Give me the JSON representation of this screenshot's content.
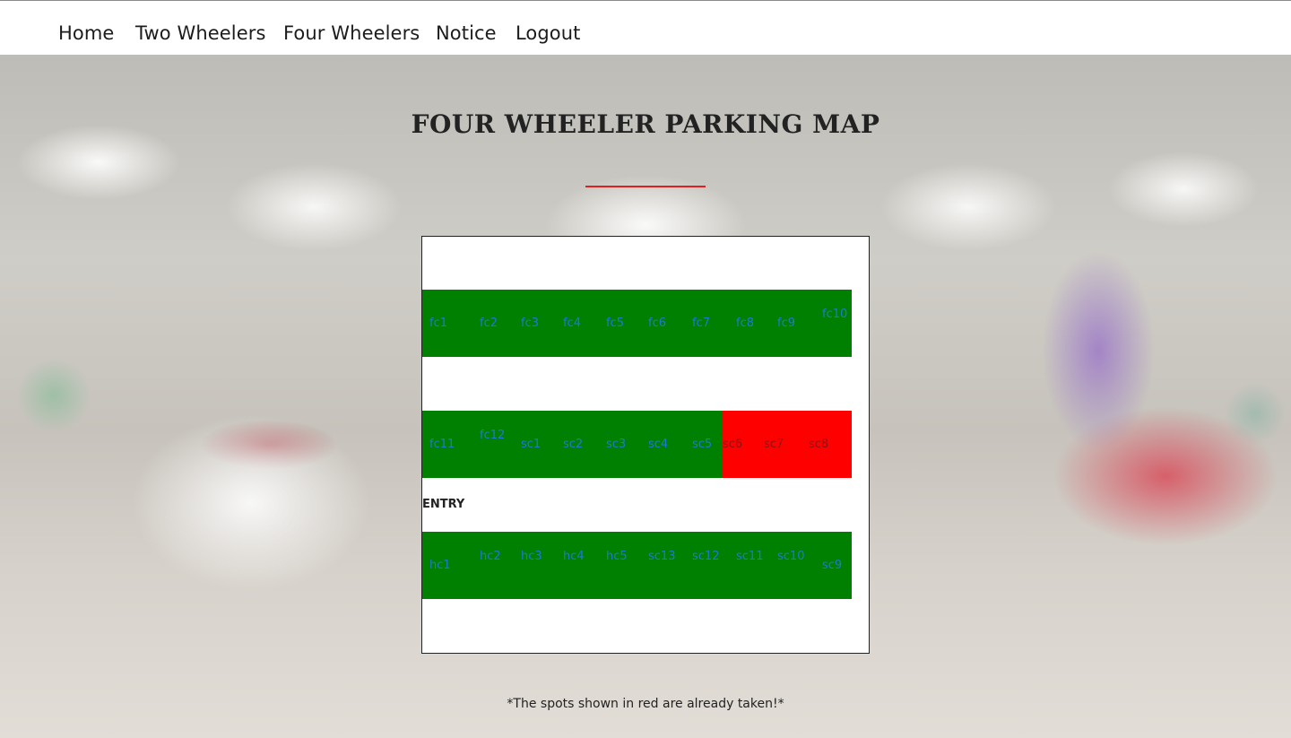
{
  "nav": {
    "items": [
      {
        "label": "Home"
      },
      {
        "label": "Two Wheelers"
      },
      {
        "label": "Four Wheelers"
      },
      {
        "label": "Notice"
      },
      {
        "label": "Logout"
      }
    ]
  },
  "page": {
    "title": "FOUR WHEELER PARKING MAP",
    "note": "*The spots shown in red are already taken!*"
  },
  "map": {
    "entry_label": "ENTRY",
    "rows": [
      {
        "spots": [
          {
            "label": "fc1",
            "status": "free"
          },
          {
            "label": "fc2",
            "status": "free"
          },
          {
            "label": "fc3",
            "status": "free"
          },
          {
            "label": "fc4",
            "status": "free"
          },
          {
            "label": "fc5",
            "status": "free"
          },
          {
            "label": "fc6",
            "status": "free"
          },
          {
            "label": "fc7",
            "status": "free"
          },
          {
            "label": "fc8",
            "status": "free"
          },
          {
            "label": "fc9",
            "status": "free"
          },
          {
            "label": "fc10",
            "status": "free"
          }
        ]
      },
      {
        "spots": [
          {
            "label": "fc11",
            "status": "free"
          },
          {
            "label": "fc12",
            "status": "free"
          },
          {
            "label": "sc1",
            "status": "free"
          },
          {
            "label": "sc2",
            "status": "free"
          },
          {
            "label": "sc3",
            "status": "free"
          },
          {
            "label": "sc4",
            "status": "free"
          },
          {
            "label": "sc5",
            "status": "free"
          },
          {
            "label": "sc6",
            "status": "taken"
          },
          {
            "label": "sc7",
            "status": "taken"
          },
          {
            "label": "sc8",
            "status": "taken"
          }
        ]
      },
      {
        "spots": [
          {
            "label": "hc1",
            "status": "free"
          },
          {
            "label": "hc2",
            "status": "free"
          },
          {
            "label": "hc3",
            "status": "free"
          },
          {
            "label": "hc4",
            "status": "free"
          },
          {
            "label": "hc5",
            "status": "free"
          },
          {
            "label": "sc13",
            "status": "free"
          },
          {
            "label": "sc12",
            "status": "free"
          },
          {
            "label": "sc11",
            "status": "free"
          },
          {
            "label": "sc10",
            "status": "free"
          },
          {
            "label": "sc9",
            "status": "free"
          }
        ]
      }
    ]
  },
  "colors": {
    "free": "#008000",
    "taken": "#ff0000",
    "label": "#1f78d6",
    "accent": "#e02020"
  }
}
